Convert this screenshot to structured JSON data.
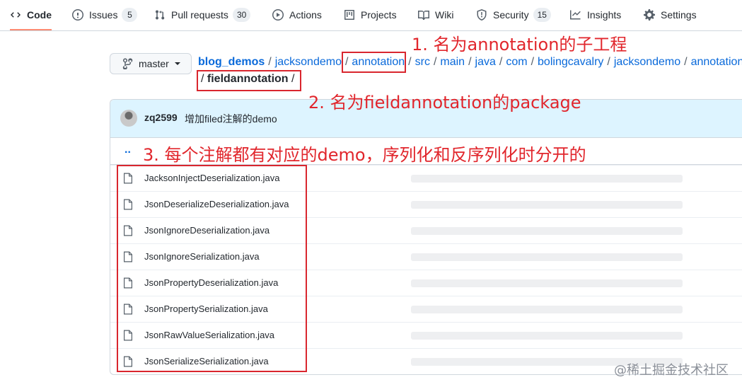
{
  "nav": {
    "tabs": [
      {
        "label": "Code",
        "icon": "code-icon",
        "active": true
      },
      {
        "label": "Issues",
        "icon": "issue-icon",
        "count": "5"
      },
      {
        "label": "Pull requests",
        "icon": "pull-request-icon",
        "count": "30"
      },
      {
        "label": "Actions",
        "icon": "play-icon"
      },
      {
        "label": "Projects",
        "icon": "project-icon"
      },
      {
        "label": "Wiki",
        "icon": "book-icon"
      },
      {
        "label": "Security",
        "icon": "shield-icon",
        "count": "15"
      },
      {
        "label": "Insights",
        "icon": "graph-icon"
      },
      {
        "label": "Settings",
        "icon": "gear-icon"
      }
    ]
  },
  "branch": {
    "label": "master"
  },
  "breadcrumb": {
    "repo": "blog_demos",
    "parts": [
      "jacksondemo",
      "annotation",
      "src",
      "main",
      "java",
      "com",
      "bolingcavalry",
      "jacksondemo",
      "annotation"
    ],
    "current": "fieldannotation",
    "slash": "/"
  },
  "annotations": {
    "note1": "1. 名为annotation的子工程",
    "note2": "2. 名为fieldannotation的package",
    "note3": "3. 每个注解都有对应的demo，序列化和反序列化时分开的",
    "color": "#d9262e"
  },
  "commit": {
    "author": "zq2599",
    "message": "增加filed注解的demo"
  },
  "updir": "..",
  "files": [
    "JacksonInjectDeserialization.java",
    "JsonDeserializeDeserialization.java",
    "JsonIgnoreDeserialization.java",
    "JsonIgnoreSerialization.java",
    "JsonPropertyDeserialization.java",
    "JsonPropertySerialization.java",
    "JsonRawValueSerialization.java",
    "JsonSerializeSerialization.java"
  ],
  "watermark": "@稀土掘金技术社区"
}
